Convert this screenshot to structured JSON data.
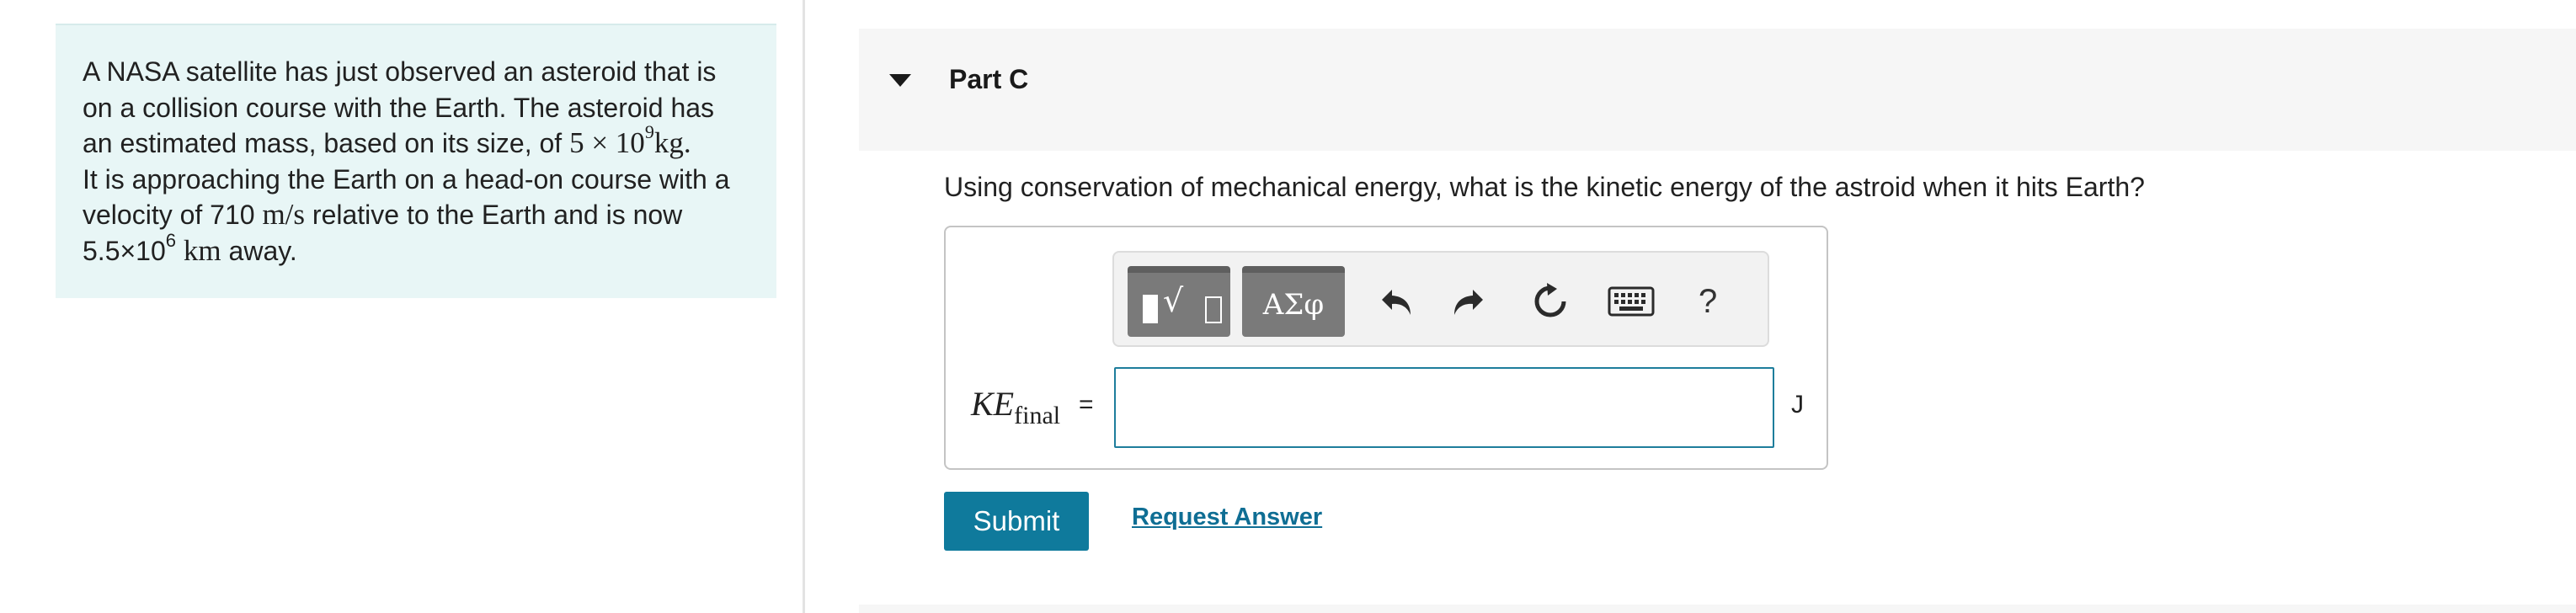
{
  "problem": {
    "line1": "A NASA satellite has just observed an asteroid that is",
    "line2": "on a collision course with the Earth. The asteroid has",
    "line3_pre": "an estimated mass, based on its size, of ",
    "mass_math": "5 × 10",
    "mass_exp": "9",
    "mass_unit": "kg.",
    "line4": "It is approaching the Earth on a head-on course with a",
    "line5_pre": "velocity of 710 ",
    "velocity_unit": "m/s",
    "line5_post": " relative to the Earth and is now",
    "distance_base": "5.5×10",
    "distance_exp": "6",
    "distance_unit": "km",
    "line6_post": " away."
  },
  "part": {
    "title": "Part C"
  },
  "question": {
    "text": "Using conservation of mechanical energy, what is the kinetic energy of the astroid when it hits Earth?"
  },
  "answer": {
    "var_main": "KE",
    "var_sub": "final",
    "equals": "=",
    "value": "",
    "unit": "J"
  },
  "toolbar": {
    "greek_label": "ΑΣφ",
    "help_label": "?",
    "icons": [
      "templates-icon",
      "undo-icon",
      "redo-icon",
      "reset-icon",
      "keyboard-icon",
      "help-icon"
    ]
  },
  "actions": {
    "submit_label": "Submit",
    "request_label": "Request Answer"
  },
  "colors": {
    "problem_bg": "#e8f6f6",
    "accent": "#0f7a9c",
    "link": "#0f6e94",
    "input_border": "#1e7d9c"
  }
}
